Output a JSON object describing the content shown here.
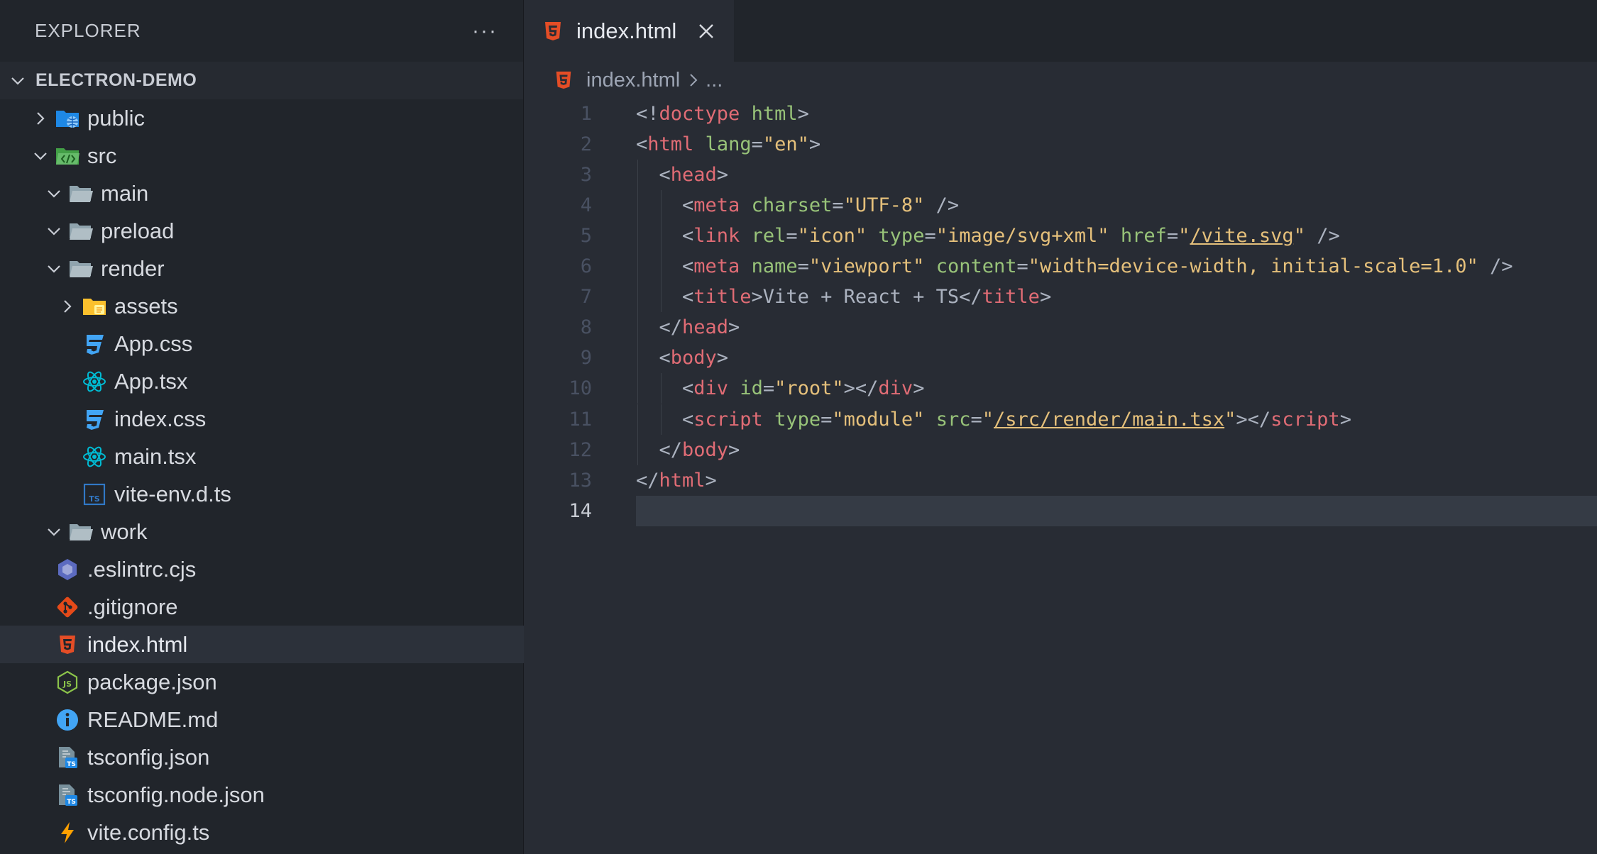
{
  "explorer": {
    "title": "EXPLORER",
    "more": "···",
    "project": "ELECTRON-DEMO",
    "items": [
      {
        "label": "public",
        "depth": 1,
        "chevron": "right",
        "icon": "folder-public-icon"
      },
      {
        "label": "src",
        "depth": 1,
        "chevron": "down",
        "icon": "folder-src-icon"
      },
      {
        "label": "main",
        "depth": 2,
        "chevron": "down",
        "icon": "folder-open-icon"
      },
      {
        "label": "preload",
        "depth": 2,
        "chevron": "down",
        "icon": "folder-open-icon"
      },
      {
        "label": "render",
        "depth": 2,
        "chevron": "down",
        "icon": "folder-open-icon"
      },
      {
        "label": "assets",
        "depth": 3,
        "chevron": "right",
        "icon": "folder-assets-icon"
      },
      {
        "label": "App.css",
        "depth": 3,
        "chevron": "none",
        "icon": "css-icon"
      },
      {
        "label": "App.tsx",
        "depth": 3,
        "chevron": "none",
        "icon": "react-icon"
      },
      {
        "label": "index.css",
        "depth": 3,
        "chevron": "none",
        "icon": "css-icon"
      },
      {
        "label": "main.tsx",
        "depth": 3,
        "chevron": "none",
        "icon": "react-icon"
      },
      {
        "label": "vite-env.d.ts",
        "depth": 3,
        "chevron": "none",
        "icon": "ts-file-icon"
      },
      {
        "label": "work",
        "depth": 2,
        "chevron": "down",
        "icon": "folder-open-icon"
      },
      {
        "label": ".eslintrc.cjs",
        "depth": 1,
        "chevron": "none",
        "icon": "eslint-icon"
      },
      {
        "label": ".gitignore",
        "depth": 1,
        "chevron": "none",
        "icon": "git-icon"
      },
      {
        "label": "index.html",
        "depth": 1,
        "chevron": "none",
        "icon": "html-icon",
        "selected": true
      },
      {
        "label": "package.json",
        "depth": 1,
        "chevron": "none",
        "icon": "nodejs-icon"
      },
      {
        "label": "README.md",
        "depth": 1,
        "chevron": "none",
        "icon": "info-icon"
      },
      {
        "label": "tsconfig.json",
        "depth": 1,
        "chevron": "none",
        "icon": "tsconfig-icon"
      },
      {
        "label": "tsconfig.node.json",
        "depth": 1,
        "chevron": "none",
        "icon": "tsconfig-icon"
      },
      {
        "label": "vite.config.ts",
        "depth": 1,
        "chevron": "none",
        "icon": "vite-icon"
      }
    ]
  },
  "tab": {
    "label": "index.html",
    "icon": "html-icon"
  },
  "breadcrumb": {
    "file": "index.html",
    "rest": "..."
  },
  "current_line": 14,
  "code": [
    {
      "n": "1",
      "indent": 0,
      "tokens": [
        [
          "p",
          "<!"
        ],
        [
          "t",
          "doctype"
        ],
        [
          "p",
          " "
        ],
        [
          "a",
          "html"
        ],
        [
          "p",
          ">"
        ]
      ]
    },
    {
      "n": "2",
      "indent": 0,
      "tokens": [
        [
          "p",
          "<"
        ],
        [
          "t",
          "html"
        ],
        [
          "p",
          " "
        ],
        [
          "a",
          "lang"
        ],
        [
          "p",
          "="
        ],
        [
          "s",
          "\"en\""
        ],
        [
          "p",
          ">"
        ]
      ]
    },
    {
      "n": "3",
      "indent": 1,
      "tokens": [
        [
          "p",
          "<"
        ],
        [
          "t",
          "head"
        ],
        [
          "p",
          ">"
        ]
      ]
    },
    {
      "n": "4",
      "indent": 2,
      "tokens": [
        [
          "p",
          "<"
        ],
        [
          "t",
          "meta"
        ],
        [
          "p",
          " "
        ],
        [
          "a",
          "charset"
        ],
        [
          "p",
          "="
        ],
        [
          "s",
          "\"UTF-8\""
        ],
        [
          "p",
          " />"
        ]
      ]
    },
    {
      "n": "5",
      "indent": 2,
      "tokens": [
        [
          "p",
          "<"
        ],
        [
          "t",
          "link"
        ],
        [
          "p",
          " "
        ],
        [
          "a",
          "rel"
        ],
        [
          "p",
          "="
        ],
        [
          "s",
          "\"icon\""
        ],
        [
          "p",
          " "
        ],
        [
          "a",
          "type"
        ],
        [
          "p",
          "="
        ],
        [
          "s",
          "\"image/svg+xml\""
        ],
        [
          "p",
          " "
        ],
        [
          "a",
          "href"
        ],
        [
          "p",
          "="
        ],
        [
          "s",
          "\""
        ],
        [
          "u",
          "/vite.svg"
        ],
        [
          "s",
          "\""
        ],
        [
          "p",
          " />"
        ]
      ]
    },
    {
      "n": "6",
      "indent": 2,
      "tokens": [
        [
          "p",
          "<"
        ],
        [
          "t",
          "meta"
        ],
        [
          "p",
          " "
        ],
        [
          "a",
          "name"
        ],
        [
          "p",
          "="
        ],
        [
          "s",
          "\"viewport\""
        ],
        [
          "p",
          " "
        ],
        [
          "a",
          "content"
        ],
        [
          "p",
          "="
        ],
        [
          "s",
          "\"width=device-width, initial-scale=1.0\""
        ],
        [
          "p",
          " />"
        ]
      ]
    },
    {
      "n": "7",
      "indent": 2,
      "tokens": [
        [
          "p",
          "<"
        ],
        [
          "t",
          "title"
        ],
        [
          "p",
          ">Vite + React + TS</"
        ],
        [
          "t",
          "title"
        ],
        [
          "p",
          ">"
        ]
      ]
    },
    {
      "n": "8",
      "indent": 1,
      "tokens": [
        [
          "p",
          "</"
        ],
        [
          "t",
          "head"
        ],
        [
          "p",
          ">"
        ]
      ]
    },
    {
      "n": "9",
      "indent": 1,
      "tokens": [
        [
          "p",
          "<"
        ],
        [
          "t",
          "body"
        ],
        [
          "p",
          ">"
        ]
      ]
    },
    {
      "n": "10",
      "indent": 2,
      "tokens": [
        [
          "p",
          "<"
        ],
        [
          "t",
          "div"
        ],
        [
          "p",
          " "
        ],
        [
          "a",
          "id"
        ],
        [
          "p",
          "="
        ],
        [
          "s",
          "\"root\""
        ],
        [
          "p",
          "></"
        ],
        [
          "t",
          "div"
        ],
        [
          "p",
          ">"
        ]
      ]
    },
    {
      "n": "11",
      "indent": 2,
      "tokens": [
        [
          "p",
          "<"
        ],
        [
          "t",
          "script"
        ],
        [
          "p",
          " "
        ],
        [
          "a",
          "type"
        ],
        [
          "p",
          "="
        ],
        [
          "s",
          "\"module\""
        ],
        [
          "p",
          " "
        ],
        [
          "a",
          "src"
        ],
        [
          "p",
          "="
        ],
        [
          "s",
          "\""
        ],
        [
          "u",
          "/src/render/main.tsx"
        ],
        [
          "s",
          "\""
        ],
        [
          "p",
          "></"
        ],
        [
          "t",
          "script"
        ],
        [
          "p",
          ">"
        ]
      ]
    },
    {
      "n": "12",
      "indent": 1,
      "tokens": [
        [
          "p",
          "</"
        ],
        [
          "t",
          "body"
        ],
        [
          "p",
          ">"
        ]
      ]
    },
    {
      "n": "13",
      "indent": 0,
      "tokens": [
        [
          "p",
          "</"
        ],
        [
          "t",
          "html"
        ],
        [
          "p",
          ">"
        ]
      ]
    },
    {
      "n": "14",
      "indent": 0,
      "tokens": []
    }
  ],
  "colors": {
    "tag": "#e06c75",
    "attribute": "#98c379",
    "string": "#e5c07b",
    "punctuation": "#abb2bf",
    "html_icon": "#e44d26",
    "css_icon": "#42a5f5",
    "react_icon": "#00bcd4"
  }
}
